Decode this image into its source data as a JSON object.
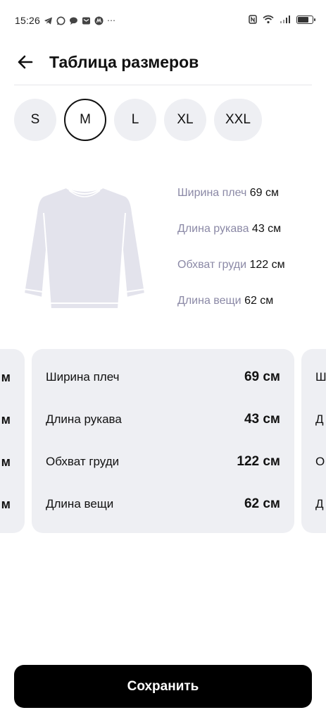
{
  "status_bar": {
    "time": "15:26",
    "left_icons": [
      "telegram-icon",
      "whatsapp-icon",
      "message-icon",
      "mail-icon",
      "app-icon",
      "more-icon"
    ],
    "right_icons": [
      "nfc-icon",
      "wifi-icon",
      "signal-icon",
      "battery-icon"
    ],
    "battery_level": 0.8
  },
  "header": {
    "title": "Таблица размеров",
    "back_icon": "arrow-left-icon"
  },
  "sizes": {
    "items": [
      "S",
      "M",
      "L",
      "XL",
      "XXL"
    ],
    "selected": "M"
  },
  "measurements": [
    {
      "label": "Ширина плеч",
      "value": "69 см"
    },
    {
      "label": "Длина рукава",
      "value": "43 см"
    },
    {
      "label": "Обхват груди",
      "value": "122 см"
    },
    {
      "label": "Длина вещи",
      "value": "62 см"
    }
  ],
  "carousel": {
    "left_card_suffix": "м",
    "right_card_prefixes": [
      "Ш",
      "Д",
      "О",
      "Д"
    ]
  },
  "save_button": {
    "label": "Сохранить"
  },
  "colors": {
    "accent": "#000000",
    "chip_bg": "#eeeff3",
    "label_muted": "#8b89a6"
  }
}
